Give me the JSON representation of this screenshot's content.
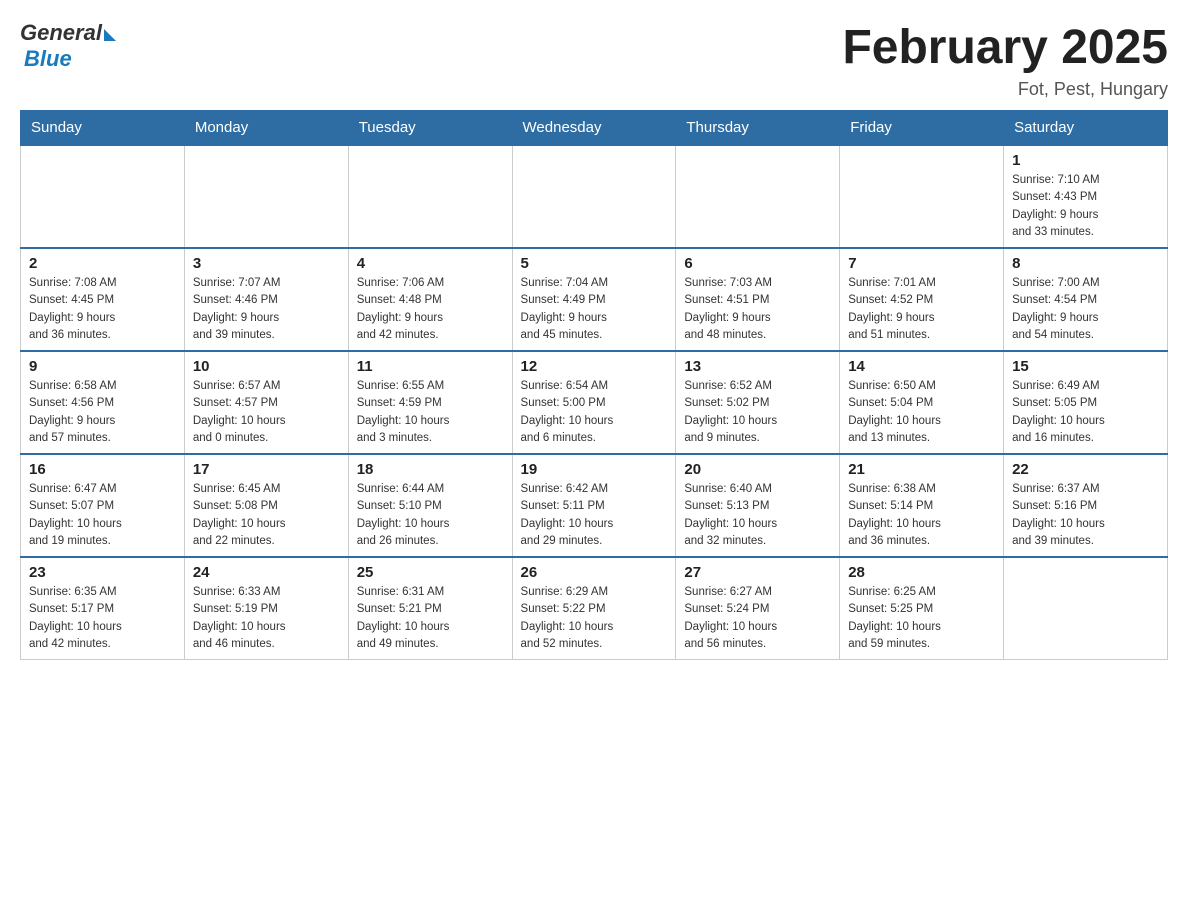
{
  "logo": {
    "general": "General",
    "blue": "Blue"
  },
  "title": "February 2025",
  "subtitle": "Fot, Pest, Hungary",
  "headers": [
    "Sunday",
    "Monday",
    "Tuesday",
    "Wednesday",
    "Thursday",
    "Friday",
    "Saturday"
  ],
  "weeks": [
    [
      {
        "day": "",
        "info": "",
        "empty": true
      },
      {
        "day": "",
        "info": "",
        "empty": true
      },
      {
        "day": "",
        "info": "",
        "empty": true
      },
      {
        "day": "",
        "info": "",
        "empty": true
      },
      {
        "day": "",
        "info": "",
        "empty": true
      },
      {
        "day": "",
        "info": "",
        "empty": true
      },
      {
        "day": "1",
        "info": "Sunrise: 7:10 AM\nSunset: 4:43 PM\nDaylight: 9 hours\nand 33 minutes.",
        "empty": false
      }
    ],
    [
      {
        "day": "2",
        "info": "Sunrise: 7:08 AM\nSunset: 4:45 PM\nDaylight: 9 hours\nand 36 minutes.",
        "empty": false
      },
      {
        "day": "3",
        "info": "Sunrise: 7:07 AM\nSunset: 4:46 PM\nDaylight: 9 hours\nand 39 minutes.",
        "empty": false
      },
      {
        "day": "4",
        "info": "Sunrise: 7:06 AM\nSunset: 4:48 PM\nDaylight: 9 hours\nand 42 minutes.",
        "empty": false
      },
      {
        "day": "5",
        "info": "Sunrise: 7:04 AM\nSunset: 4:49 PM\nDaylight: 9 hours\nand 45 minutes.",
        "empty": false
      },
      {
        "day": "6",
        "info": "Sunrise: 7:03 AM\nSunset: 4:51 PM\nDaylight: 9 hours\nand 48 minutes.",
        "empty": false
      },
      {
        "day": "7",
        "info": "Sunrise: 7:01 AM\nSunset: 4:52 PM\nDaylight: 9 hours\nand 51 minutes.",
        "empty": false
      },
      {
        "day": "8",
        "info": "Sunrise: 7:00 AM\nSunset: 4:54 PM\nDaylight: 9 hours\nand 54 minutes.",
        "empty": false
      }
    ],
    [
      {
        "day": "9",
        "info": "Sunrise: 6:58 AM\nSunset: 4:56 PM\nDaylight: 9 hours\nand 57 minutes.",
        "empty": false
      },
      {
        "day": "10",
        "info": "Sunrise: 6:57 AM\nSunset: 4:57 PM\nDaylight: 10 hours\nand 0 minutes.",
        "empty": false
      },
      {
        "day": "11",
        "info": "Sunrise: 6:55 AM\nSunset: 4:59 PM\nDaylight: 10 hours\nand 3 minutes.",
        "empty": false
      },
      {
        "day": "12",
        "info": "Sunrise: 6:54 AM\nSunset: 5:00 PM\nDaylight: 10 hours\nand 6 minutes.",
        "empty": false
      },
      {
        "day": "13",
        "info": "Sunrise: 6:52 AM\nSunset: 5:02 PM\nDaylight: 10 hours\nand 9 minutes.",
        "empty": false
      },
      {
        "day": "14",
        "info": "Sunrise: 6:50 AM\nSunset: 5:04 PM\nDaylight: 10 hours\nand 13 minutes.",
        "empty": false
      },
      {
        "day": "15",
        "info": "Sunrise: 6:49 AM\nSunset: 5:05 PM\nDaylight: 10 hours\nand 16 minutes.",
        "empty": false
      }
    ],
    [
      {
        "day": "16",
        "info": "Sunrise: 6:47 AM\nSunset: 5:07 PM\nDaylight: 10 hours\nand 19 minutes.",
        "empty": false
      },
      {
        "day": "17",
        "info": "Sunrise: 6:45 AM\nSunset: 5:08 PM\nDaylight: 10 hours\nand 22 minutes.",
        "empty": false
      },
      {
        "day": "18",
        "info": "Sunrise: 6:44 AM\nSunset: 5:10 PM\nDaylight: 10 hours\nand 26 minutes.",
        "empty": false
      },
      {
        "day": "19",
        "info": "Sunrise: 6:42 AM\nSunset: 5:11 PM\nDaylight: 10 hours\nand 29 minutes.",
        "empty": false
      },
      {
        "day": "20",
        "info": "Sunrise: 6:40 AM\nSunset: 5:13 PM\nDaylight: 10 hours\nand 32 minutes.",
        "empty": false
      },
      {
        "day": "21",
        "info": "Sunrise: 6:38 AM\nSunset: 5:14 PM\nDaylight: 10 hours\nand 36 minutes.",
        "empty": false
      },
      {
        "day": "22",
        "info": "Sunrise: 6:37 AM\nSunset: 5:16 PM\nDaylight: 10 hours\nand 39 minutes.",
        "empty": false
      }
    ],
    [
      {
        "day": "23",
        "info": "Sunrise: 6:35 AM\nSunset: 5:17 PM\nDaylight: 10 hours\nand 42 minutes.",
        "empty": false
      },
      {
        "day": "24",
        "info": "Sunrise: 6:33 AM\nSunset: 5:19 PM\nDaylight: 10 hours\nand 46 minutes.",
        "empty": false
      },
      {
        "day": "25",
        "info": "Sunrise: 6:31 AM\nSunset: 5:21 PM\nDaylight: 10 hours\nand 49 minutes.",
        "empty": false
      },
      {
        "day": "26",
        "info": "Sunrise: 6:29 AM\nSunset: 5:22 PM\nDaylight: 10 hours\nand 52 minutes.",
        "empty": false
      },
      {
        "day": "27",
        "info": "Sunrise: 6:27 AM\nSunset: 5:24 PM\nDaylight: 10 hours\nand 56 minutes.",
        "empty": false
      },
      {
        "day": "28",
        "info": "Sunrise: 6:25 AM\nSunset: 5:25 PM\nDaylight: 10 hours\nand 59 minutes.",
        "empty": false
      },
      {
        "day": "",
        "info": "",
        "empty": true
      }
    ]
  ]
}
